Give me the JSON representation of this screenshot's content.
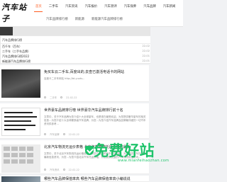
{
  "header": {
    "logo": "汽车站子",
    "nav": [
      "首页",
      "二手车",
      "汽车资讯",
      "汽车报价",
      "汽车测评",
      "汽车保养",
      "汽车品牌",
      "汽车新闻"
    ],
    "active_nav": 0,
    "subnav": [
      "汽车品牌排行榜",
      "新能源",
      "新能源汽车品牌排行榜"
    ]
  },
  "top_list": [
    {
      "text": "汽车品牌排行榜",
      "date": ""
    },
    {
      "text": "百千车（百车）",
      "date": "22-02"
    },
    {
      "text": "二手车（二手车品牌）",
      "date": "22-02"
    },
    {
      "text": "汽车品牌排行榜2022",
      "date": "22-01"
    },
    {
      "text": "新能源汽车品牌排行榜",
      "date": "22-01"
    }
  ],
  "articles": [
    {
      "title": "免买车云二手车,百度出的,去查已激活电话卡的网站",
      "desc": "百度卡二手车网站 http://bt.yuxtv...",
      "meta": [
        "二手车",
        "22-02-22"
      ]
    },
    {
      "title": "世界豪车品牌排行榜 世界豪华汽车品牌排行前十名",
      "desc": "文章中，关于汽车品牌为您介绍十大全球豪车，也是现在最受欢迎，为您提供奢华豪车的相关信息…为您介绍十大全球奢侈级汽车品牌，为您…为您介绍汽车品牌及品牌最详细的一切汽车资讯供参考…",
      "meta": [
        "汽车品牌",
        "22-02-22"
      ]
    },
    {
      "title": "北京汽车物流无运价表格 北京汽车物流托运价格表最新",
      "desc": "文章中，关于北京汽车物流托运价格信息，为您介绍各种汽车物流价格，为您提供汽车托运的最新信息资讯，为您…为您介绍北京汽车托运价格，为您提供完整的汽车物流信息资讯…",
      "meta": [
        "汽车资讯",
        "22-02-22"
      ]
    },
    {
      "title": "哪些汽车品牌保值率高 哪些汽车品牌保值率高小编说说",
      "desc": "",
      "meta": []
    }
  ],
  "watermark": {
    "brand": "免费好站",
    "url": "www.mianfeihaozhan.com"
  },
  "colors": {
    "accent": "#ff5b1f",
    "watermark": "#1ec36a"
  }
}
